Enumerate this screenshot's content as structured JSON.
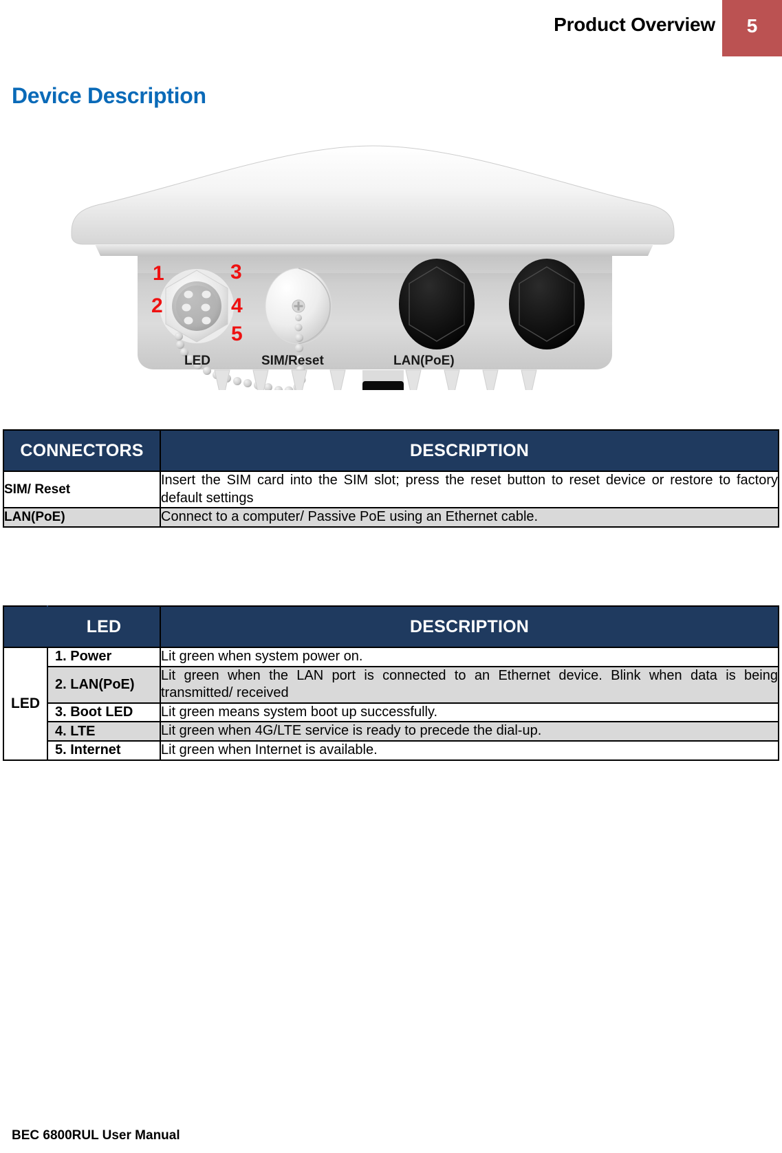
{
  "header": {
    "title": "Product Overview",
    "page_number": "5",
    "accent_color": "#BB5252"
  },
  "section": {
    "title": "Device Description",
    "title_color": "#0A6AB8"
  },
  "figure": {
    "alt": "BEC 6800RUL outdoor access point bottom view",
    "callouts": [
      "1",
      "2",
      "3",
      "4",
      "5"
    ],
    "callout_color": "#EE1111",
    "port_labels": [
      "LED",
      "SIM/Reset",
      "LAN(PoE)"
    ]
  },
  "connectors_table": {
    "headers": [
      "CONNECTORS",
      "DESCRIPTION"
    ],
    "header_bg": "#1F3A5F",
    "rows": [
      {
        "label": "SIM/ Reset",
        "description": "Insert the SIM card into the SIM slot; press the reset button to reset device or restore to factory default settings",
        "shaded": false
      },
      {
        "label": "LAN(PoE)",
        "description": "Connect to a computer/ Passive PoE using an Ethernet cable.",
        "shaded": true
      }
    ]
  },
  "led_table": {
    "headers": [
      "LED",
      "DESCRIPTION"
    ],
    "header_bg": "#1F3A5F",
    "group_label": "LED",
    "rows": [
      {
        "label": "1. Power",
        "description": "Lit green when system power on.",
        "shaded": false
      },
      {
        "label": "2. LAN(PoE)",
        "description": "Lit green when the LAN port is connected to an Ethernet device. Blink when data is being transmitted/ received",
        "shaded": true
      },
      {
        "label": "3. Boot LED",
        "description": "Lit green means system boot up successfully.",
        "shaded": false
      },
      {
        "label": "4. LTE",
        "description": "Lit green when 4G/LTE service is ready to precede the dial-up.",
        "shaded": true
      },
      {
        "label": "5. Internet",
        "description": "Lit green when Internet is available.",
        "shaded": false
      }
    ]
  },
  "footer": {
    "text": "BEC 6800RUL User Manual"
  }
}
